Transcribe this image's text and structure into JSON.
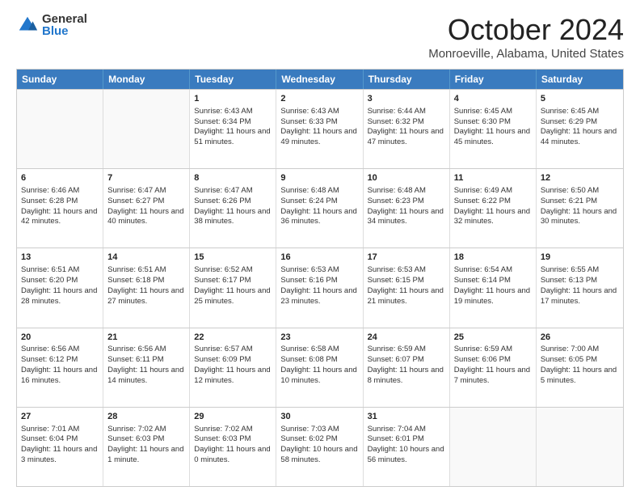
{
  "logo": {
    "general": "General",
    "blue": "Blue"
  },
  "header": {
    "title": "October 2024",
    "subtitle": "Monroeville, Alabama, United States"
  },
  "weekdays": [
    "Sunday",
    "Monday",
    "Tuesday",
    "Wednesday",
    "Thursday",
    "Friday",
    "Saturday"
  ],
  "weeks": [
    [
      {
        "day": "",
        "sunrise": "",
        "sunset": "",
        "daylight": ""
      },
      {
        "day": "",
        "sunrise": "",
        "sunset": "",
        "daylight": ""
      },
      {
        "day": "1",
        "sunrise": "Sunrise: 6:43 AM",
        "sunset": "Sunset: 6:34 PM",
        "daylight": "Daylight: 11 hours and 51 minutes."
      },
      {
        "day": "2",
        "sunrise": "Sunrise: 6:43 AM",
        "sunset": "Sunset: 6:33 PM",
        "daylight": "Daylight: 11 hours and 49 minutes."
      },
      {
        "day": "3",
        "sunrise": "Sunrise: 6:44 AM",
        "sunset": "Sunset: 6:32 PM",
        "daylight": "Daylight: 11 hours and 47 minutes."
      },
      {
        "day": "4",
        "sunrise": "Sunrise: 6:45 AM",
        "sunset": "Sunset: 6:30 PM",
        "daylight": "Daylight: 11 hours and 45 minutes."
      },
      {
        "day": "5",
        "sunrise": "Sunrise: 6:45 AM",
        "sunset": "Sunset: 6:29 PM",
        "daylight": "Daylight: 11 hours and 44 minutes."
      }
    ],
    [
      {
        "day": "6",
        "sunrise": "Sunrise: 6:46 AM",
        "sunset": "Sunset: 6:28 PM",
        "daylight": "Daylight: 11 hours and 42 minutes."
      },
      {
        "day": "7",
        "sunrise": "Sunrise: 6:47 AM",
        "sunset": "Sunset: 6:27 PM",
        "daylight": "Daylight: 11 hours and 40 minutes."
      },
      {
        "day": "8",
        "sunrise": "Sunrise: 6:47 AM",
        "sunset": "Sunset: 6:26 PM",
        "daylight": "Daylight: 11 hours and 38 minutes."
      },
      {
        "day": "9",
        "sunrise": "Sunrise: 6:48 AM",
        "sunset": "Sunset: 6:24 PM",
        "daylight": "Daylight: 11 hours and 36 minutes."
      },
      {
        "day": "10",
        "sunrise": "Sunrise: 6:48 AM",
        "sunset": "Sunset: 6:23 PM",
        "daylight": "Daylight: 11 hours and 34 minutes."
      },
      {
        "day": "11",
        "sunrise": "Sunrise: 6:49 AM",
        "sunset": "Sunset: 6:22 PM",
        "daylight": "Daylight: 11 hours and 32 minutes."
      },
      {
        "day": "12",
        "sunrise": "Sunrise: 6:50 AM",
        "sunset": "Sunset: 6:21 PM",
        "daylight": "Daylight: 11 hours and 30 minutes."
      }
    ],
    [
      {
        "day": "13",
        "sunrise": "Sunrise: 6:51 AM",
        "sunset": "Sunset: 6:20 PM",
        "daylight": "Daylight: 11 hours and 28 minutes."
      },
      {
        "day": "14",
        "sunrise": "Sunrise: 6:51 AM",
        "sunset": "Sunset: 6:18 PM",
        "daylight": "Daylight: 11 hours and 27 minutes."
      },
      {
        "day": "15",
        "sunrise": "Sunrise: 6:52 AM",
        "sunset": "Sunset: 6:17 PM",
        "daylight": "Daylight: 11 hours and 25 minutes."
      },
      {
        "day": "16",
        "sunrise": "Sunrise: 6:53 AM",
        "sunset": "Sunset: 6:16 PM",
        "daylight": "Daylight: 11 hours and 23 minutes."
      },
      {
        "day": "17",
        "sunrise": "Sunrise: 6:53 AM",
        "sunset": "Sunset: 6:15 PM",
        "daylight": "Daylight: 11 hours and 21 minutes."
      },
      {
        "day": "18",
        "sunrise": "Sunrise: 6:54 AM",
        "sunset": "Sunset: 6:14 PM",
        "daylight": "Daylight: 11 hours and 19 minutes."
      },
      {
        "day": "19",
        "sunrise": "Sunrise: 6:55 AM",
        "sunset": "Sunset: 6:13 PM",
        "daylight": "Daylight: 11 hours and 17 minutes."
      }
    ],
    [
      {
        "day": "20",
        "sunrise": "Sunrise: 6:56 AM",
        "sunset": "Sunset: 6:12 PM",
        "daylight": "Daylight: 11 hours and 16 minutes."
      },
      {
        "day": "21",
        "sunrise": "Sunrise: 6:56 AM",
        "sunset": "Sunset: 6:11 PM",
        "daylight": "Daylight: 11 hours and 14 minutes."
      },
      {
        "day": "22",
        "sunrise": "Sunrise: 6:57 AM",
        "sunset": "Sunset: 6:09 PM",
        "daylight": "Daylight: 11 hours and 12 minutes."
      },
      {
        "day": "23",
        "sunrise": "Sunrise: 6:58 AM",
        "sunset": "Sunset: 6:08 PM",
        "daylight": "Daylight: 11 hours and 10 minutes."
      },
      {
        "day": "24",
        "sunrise": "Sunrise: 6:59 AM",
        "sunset": "Sunset: 6:07 PM",
        "daylight": "Daylight: 11 hours and 8 minutes."
      },
      {
        "day": "25",
        "sunrise": "Sunrise: 6:59 AM",
        "sunset": "Sunset: 6:06 PM",
        "daylight": "Daylight: 11 hours and 7 minutes."
      },
      {
        "day": "26",
        "sunrise": "Sunrise: 7:00 AM",
        "sunset": "Sunset: 6:05 PM",
        "daylight": "Daylight: 11 hours and 5 minutes."
      }
    ],
    [
      {
        "day": "27",
        "sunrise": "Sunrise: 7:01 AM",
        "sunset": "Sunset: 6:04 PM",
        "daylight": "Daylight: 11 hours and 3 minutes."
      },
      {
        "day": "28",
        "sunrise": "Sunrise: 7:02 AM",
        "sunset": "Sunset: 6:03 PM",
        "daylight": "Daylight: 11 hours and 1 minute."
      },
      {
        "day": "29",
        "sunrise": "Sunrise: 7:02 AM",
        "sunset": "Sunset: 6:03 PM",
        "daylight": "Daylight: 11 hours and 0 minutes."
      },
      {
        "day": "30",
        "sunrise": "Sunrise: 7:03 AM",
        "sunset": "Sunset: 6:02 PM",
        "daylight": "Daylight: 10 hours and 58 minutes."
      },
      {
        "day": "31",
        "sunrise": "Sunrise: 7:04 AM",
        "sunset": "Sunset: 6:01 PM",
        "daylight": "Daylight: 10 hours and 56 minutes."
      },
      {
        "day": "",
        "sunrise": "",
        "sunset": "",
        "daylight": ""
      },
      {
        "day": "",
        "sunrise": "",
        "sunset": "",
        "daylight": ""
      }
    ]
  ]
}
